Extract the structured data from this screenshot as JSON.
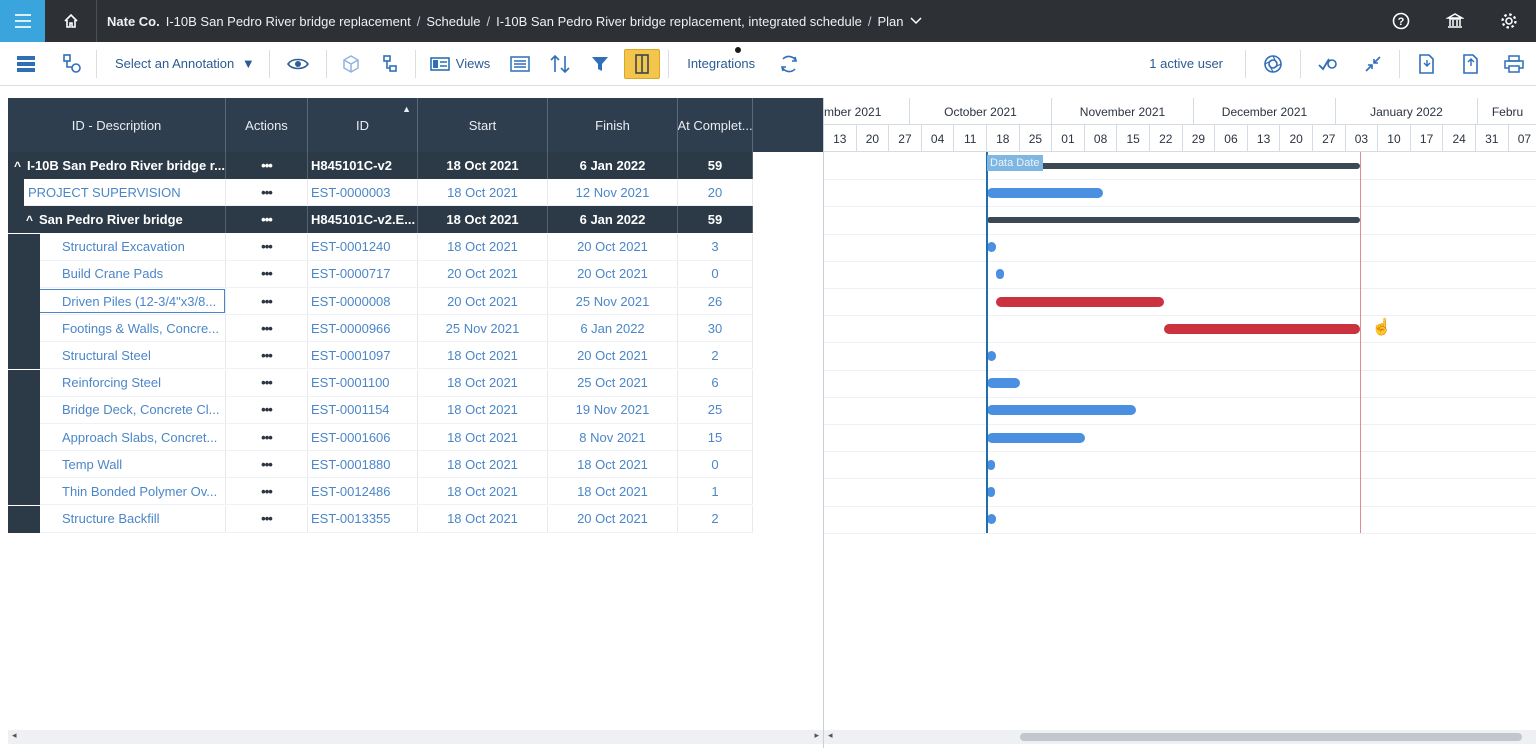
{
  "topbar": {
    "company": "Nate Co.",
    "crumbs": [
      "I-10B San Pedro River bridge replacement",
      "Schedule",
      "I-10B San Pedro River bridge replacement, integrated schedule",
      "Plan"
    ],
    "sep": "/",
    "accent": "#3aa4dd"
  },
  "toolbar": {
    "annotation_label": "Select an Annotation",
    "views_label": "Views",
    "integrations_label": "Integrations",
    "active_users": "1 active user"
  },
  "grid": {
    "columns": [
      "ID - Description",
      "Actions",
      "ID",
      "Start",
      "Finish",
      "At Complet..."
    ],
    "rows": [
      {
        "type": "dark",
        "indent": 0,
        "expand": "^",
        "desc": "I-10B San Pedro River bridge r...",
        "actions": "•••",
        "id": "H845101C-v2",
        "start": "18 Oct 2021",
        "finish": "6 Jan 2022",
        "atc": "59"
      },
      {
        "type": "lite",
        "indent": 1,
        "desc": "PROJECT SUPERVISION",
        "actions": "•••",
        "id": "EST-0000003",
        "start": "18 Oct 2021",
        "finish": "12 Nov 2021",
        "atc": "20"
      },
      {
        "type": "dark",
        "indent": 1,
        "expand": "^",
        "desc": "San Pedro River bridge",
        "actions": "•••",
        "id": "H845101C-v2.E...",
        "start": "18 Oct 2021",
        "finish": "6 Jan 2022",
        "atc": "59"
      },
      {
        "type": "lite",
        "indent": 2,
        "desc": "Structural Excavation",
        "actions": "•••",
        "id": "EST-0001240",
        "start": "18 Oct 2021",
        "finish": "20 Oct 2021",
        "atc": "3"
      },
      {
        "type": "lite",
        "indent": 2,
        "desc": "Build Crane Pads",
        "actions": "•••",
        "id": "EST-0000717",
        "start": "20 Oct 2021",
        "finish": "20 Oct 2021",
        "atc": "0"
      },
      {
        "type": "lite",
        "indent": 2,
        "desc": "Driven Piles (12-3/4\"x3/8...",
        "actions": "•••",
        "id": "EST-0000008",
        "start": "20 Oct 2021",
        "finish": "25 Nov 2021",
        "atc": "26"
      },
      {
        "type": "lite",
        "indent": 2,
        "desc": "Footings & Walls, Concre...",
        "actions": "•••",
        "id": "EST-0000966",
        "start": "25 Nov 2021",
        "finish": "6 Jan 2022",
        "atc": "30"
      },
      {
        "type": "lite",
        "indent": 2,
        "desc": "Structural Steel",
        "actions": "•••",
        "id": "EST-0001097",
        "start": "18 Oct 2021",
        "finish": "20 Oct 2021",
        "atc": "2"
      },
      {
        "type": "lite",
        "indent": 2,
        "desc": "Reinforcing Steel",
        "actions": "•••",
        "id": "EST-0001100",
        "start": "18 Oct 2021",
        "finish": "25 Oct 2021",
        "atc": "6"
      },
      {
        "type": "lite",
        "indent": 2,
        "desc": "Bridge Deck, Concrete Cl...",
        "actions": "•••",
        "id": "EST-0001154",
        "start": "18 Oct 2021",
        "finish": "19 Nov 2021",
        "atc": "25"
      },
      {
        "type": "lite",
        "indent": 2,
        "desc": "Approach Slabs, Concret...",
        "actions": "•••",
        "id": "EST-0001606",
        "start": "18 Oct 2021",
        "finish": "8 Nov 2021",
        "atc": "15"
      },
      {
        "type": "lite",
        "indent": 2,
        "desc": "Temp Wall",
        "actions": "•••",
        "id": "EST-0001880",
        "start": "18 Oct 2021",
        "finish": "18 Oct 2021",
        "atc": "0"
      },
      {
        "type": "lite",
        "indent": 2,
        "desc": "Thin Bonded Polymer Ov...",
        "actions": "•••",
        "id": "EST-0012486",
        "start": "18 Oct 2021",
        "finish": "18 Oct 2021",
        "atc": "1"
      },
      {
        "type": "lite",
        "indent": 2,
        "desc": "Structure Backfill",
        "actions": "•••",
        "id": "EST-0013355",
        "start": "18 Oct 2021",
        "finish": "20 Oct 2021",
        "atc": "2"
      }
    ]
  },
  "gantt": {
    "months": [
      "mber 2021",
      "October 2021",
      "November 2021",
      "December 2021",
      "January 2022",
      "Febru"
    ],
    "days": [
      "13",
      "20",
      "27",
      "04",
      "11",
      "18",
      "25",
      "01",
      "08",
      "15",
      "22",
      "29",
      "06",
      "13",
      "20",
      "27",
      "03",
      "10",
      "17",
      "24",
      "31",
      "07"
    ],
    "data_date_label": "Data Date",
    "data_date": "18 Oct 2021",
    "finish_marker": "6 Jan 2022",
    "colors": {
      "normal": "#4a8fe0",
      "critical": "#c9323e",
      "summary": "#3d4855",
      "data_date_line": "#1f6fae",
      "finish_line": "#e08a92"
    }
  }
}
